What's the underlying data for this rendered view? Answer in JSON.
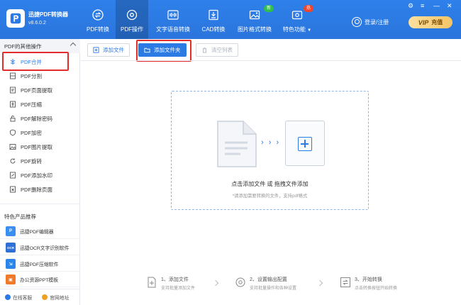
{
  "app": {
    "title": "迅捷PDF转换器",
    "version": "v8.6.0.2"
  },
  "nav": {
    "tabs": [
      {
        "label": "PDF转换",
        "icon": "swap-icon"
      },
      {
        "label": "PDF操作",
        "icon": "gear-icon",
        "active": true
      },
      {
        "label": "文字语音转换",
        "icon": "waveform-icon"
      },
      {
        "label": "CAD转换",
        "icon": "cad-icon"
      },
      {
        "label": "图片格式转换",
        "icon": "image-icon",
        "badge": "新"
      },
      {
        "label": "特色功能",
        "icon": "feature-icon",
        "badge": "热",
        "dropdown": true
      }
    ],
    "login_label": "登录/注册",
    "vip_label": "VIP",
    "vip_action": "充值",
    "window_controls": {
      "skin": "⚙",
      "menu": "≡",
      "minimize": "—",
      "close": "✕"
    }
  },
  "sidebar": {
    "section_title": "PDF的其他操作",
    "items": [
      {
        "label": "PDF合并",
        "icon": "merge-icon",
        "active": true
      },
      {
        "label": "PDF分割",
        "icon": "split-icon"
      },
      {
        "label": "PDF页面提取",
        "icon": "page-extract-icon"
      },
      {
        "label": "PDF压缩",
        "icon": "compress-icon"
      },
      {
        "label": "PDF解除密码",
        "icon": "unlock-icon"
      },
      {
        "label": "PDF加密",
        "icon": "shield-icon"
      },
      {
        "label": "PDF图片提取",
        "icon": "image-extract-icon"
      },
      {
        "label": "PDF旋转",
        "icon": "rotate-icon"
      },
      {
        "label": "PDF添加水印",
        "icon": "watermark-icon"
      },
      {
        "label": "PDF删除页面",
        "icon": "delete-page-icon"
      }
    ],
    "recommend_title": "特色产品推荐",
    "recommend": [
      {
        "label": "迅捷PDF编辑器",
        "icon": "pdf-editor-icon",
        "color": "#3b8ff0"
      },
      {
        "label": "迅捷OCR文字识别软件",
        "icon": "ocr-icon",
        "color": "#2f6fd8"
      },
      {
        "label": "迅捷PDF压缩软件",
        "icon": "pdf-compress-icon",
        "color": "#2a86e8"
      },
      {
        "label": "办公资源PPT模板",
        "icon": "ppt-icon",
        "color": "#f07a2a"
      }
    ],
    "footer": {
      "support_label": "在线客服",
      "website_label": "官网地址"
    }
  },
  "toolbar": {
    "add_file_label": "添加文件",
    "add_folder_label": "添加文件夹",
    "clear_list_label": "清空列表"
  },
  "dropzone": {
    "title": "点击添加文件 或 拖拽文件添加",
    "hint": "*请添加需要转换的文件，支持pdf格式",
    "arrows": "› › ›"
  },
  "steps": [
    {
      "title": "1、添加文件",
      "desc": "支持批量添加文件"
    },
    {
      "title": "2、设置输出配置",
      "desc": "支持批量操作和各种设置"
    },
    {
      "title": "3、开始转换",
      "desc": "点击转换按钮开始转换"
    }
  ],
  "colors": {
    "brand": "#2c7be5",
    "highlight": "#e32d2d",
    "vip": "#f4c466"
  }
}
